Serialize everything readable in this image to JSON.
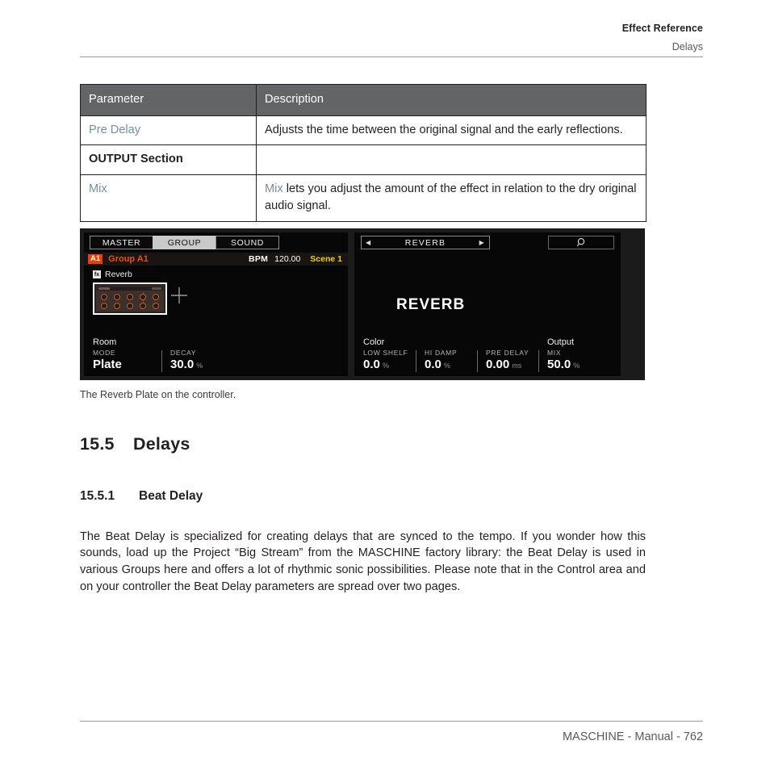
{
  "header": {
    "title": "Effect Reference",
    "subtitle": "Delays"
  },
  "param_table": {
    "columns": [
      "Parameter",
      "Description"
    ],
    "rows": [
      {
        "parameter": "Pre Delay",
        "parameter_style": "link",
        "description": "Adjusts the time between the original signal and the early reflections."
      },
      {
        "parameter": "OUTPUT Section",
        "parameter_style": "bold",
        "description": ""
      },
      {
        "parameter": "Mix",
        "parameter_style": "link",
        "description_link": "Mix",
        "description": " lets you adjust the amount of the effect in relation to the dry original audio signal."
      }
    ]
  },
  "controller": {
    "left_display": {
      "tabs": [
        {
          "label": "MASTER",
          "selected": false
        },
        {
          "label": "GROUP",
          "selected": true
        },
        {
          "label": "SOUND",
          "selected": false
        }
      ],
      "badge": "A1",
      "group_name": "Group A1",
      "bpm_label": "BPM",
      "bpm_value": "120.00",
      "scene": "Scene 1",
      "fx_chip": "fx",
      "fx_name": "Reverb",
      "add_icon": "plus-icon",
      "section_label": "Room",
      "params": [
        {
          "name": "MODE",
          "value": "Plate",
          "unit": ""
        },
        {
          "name": "DECAY",
          "value": "30.0",
          "unit": "%"
        }
      ]
    },
    "right_display": {
      "nav_prev": "◀",
      "nav_label": "REVERB",
      "nav_next": "▶",
      "search_icon": "search-icon",
      "title": "REVERB",
      "group_color": "Color",
      "group_output": "Output",
      "params": [
        {
          "name": "LOW SHELF",
          "value": "0.0",
          "unit": "%"
        },
        {
          "name": "HI DAMP",
          "value": "0.0",
          "unit": "%"
        },
        {
          "name": "PRE DELAY",
          "value": "0.00",
          "unit": "ms"
        },
        {
          "name": "MIX",
          "value": "50.0",
          "unit": "%"
        }
      ]
    }
  },
  "figure_caption": "The Reverb Plate on the controller.",
  "headings": {
    "section_number": "15.5",
    "section_title": "Delays",
    "subsection_number": "15.5.1",
    "subsection_title": "Beat Delay"
  },
  "body": {
    "paragraph": "The Beat Delay is specialized for creating delays that are synced to the tempo. If you wonder how this sounds, load up the Project “Big Stream” from the MASCHINE factory library: the Beat Delay is used in various Groups here and offers a lot of rhythmic sonic possibilities. Please note that in the Control area and on your controller the Beat Delay parameters are spread over two pages."
  },
  "footer": {
    "text": "MASCHINE - Manual - 762"
  },
  "colors": {
    "link": "#6f8fa8",
    "table_header_bg": "#636466",
    "accent_orange": "#f04c12",
    "badge_orange": "#f03c02",
    "scene_yellow": "#f0d000"
  }
}
